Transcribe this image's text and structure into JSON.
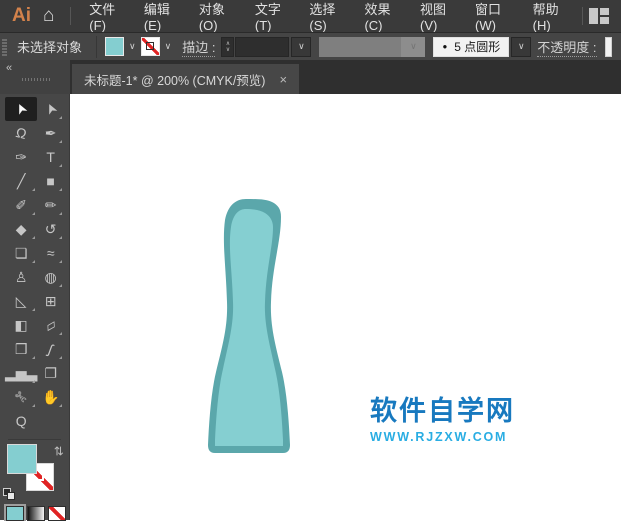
{
  "app": {
    "logo_text": "Ai",
    "home_icon_glyph": "⌂"
  },
  "menu_bar": {
    "items": [
      {
        "id": "file",
        "label": "文件(F)"
      },
      {
        "id": "edit",
        "label": "编辑(E)"
      },
      {
        "id": "object",
        "label": "对象(O)"
      },
      {
        "id": "type",
        "label": "文字(T)"
      },
      {
        "id": "select",
        "label": "选择(S)"
      },
      {
        "id": "effect",
        "label": "效果(C)"
      },
      {
        "id": "view",
        "label": "视图(V)"
      },
      {
        "id": "window",
        "label": "窗口(W)"
      },
      {
        "id": "help",
        "label": "帮助(H)"
      }
    ]
  },
  "control_bar": {
    "status": "未选择对象",
    "fill_swatch_color": "#84CED0",
    "chevron_glyph": "∨",
    "stepper_up": "∧",
    "stepper_down": "∨",
    "stroke_label": "描边 :",
    "stroke_value": "",
    "brush_preset": {
      "dot": "●",
      "label": "5 点圆形"
    },
    "opacity_label": "不透明度 :"
  },
  "tab_bar": {
    "collapse_glyph": "«",
    "tab_title": "未标题-1* @ 200% (CMYK/预览)",
    "close_glyph": "×"
  },
  "toolbar": {
    "swap_glyph": "⇄",
    "tools": [
      {
        "name": "selection-tool",
        "icon": "selection-arrow-icon",
        "glyph": "➤",
        "rot": -115,
        "active": true
      },
      {
        "name": "direct-selection-tool",
        "icon": "direct-select-arrow-icon",
        "glyph": "➤",
        "rot": -115,
        "flyout": true
      },
      {
        "name": "lasso-tool",
        "icon": "lasso-icon",
        "glyph": "Ω",
        "rot": 14
      },
      {
        "name": "pen-tool",
        "icon": "pen-nib-icon",
        "glyph": "✒",
        "flyout": true
      },
      {
        "name": "curvature-tool",
        "icon": "curvature-pen-icon",
        "glyph": "✑"
      },
      {
        "name": "type-tool",
        "icon": "type-icon",
        "glyph": "T",
        "flyout": true
      },
      {
        "name": "line-segment-tool",
        "icon": "line-icon",
        "glyph": "╱",
        "flyout": true
      },
      {
        "name": "rectangle-tool",
        "icon": "rectangle-icon",
        "glyph": "■",
        "flyout": true
      },
      {
        "name": "paintbrush-tool",
        "icon": "paintbrush-icon",
        "glyph": "✐",
        "flyout": true
      },
      {
        "name": "pencil-tool",
        "icon": "pencil-icon",
        "glyph": "✏",
        "flyout": true
      },
      {
        "name": "eraser-tool",
        "icon": "eraser-icon",
        "glyph": "◆",
        "flyout": true
      },
      {
        "name": "rotate-tool",
        "icon": "rotate-icon",
        "glyph": "↺",
        "flyout": true
      },
      {
        "name": "scale-tool",
        "icon": "scale-icon",
        "glyph": "❏",
        "flyout": true
      },
      {
        "name": "width-tool",
        "icon": "width-icon",
        "glyph": "≈",
        "flyout": true
      },
      {
        "name": "puppet-warp-tool",
        "icon": "pushpin-icon",
        "glyph": "♙"
      },
      {
        "name": "shape-builder-tool",
        "icon": "shape-builder-icon",
        "glyph": "◍",
        "flyout": true
      },
      {
        "name": "perspective-grid-tool",
        "icon": "perspective-grid-icon",
        "glyph": "◺",
        "flyout": true
      },
      {
        "name": "mesh-tool",
        "icon": "mesh-icon",
        "glyph": "⊞"
      },
      {
        "name": "gradient-tool",
        "icon": "gradient-icon",
        "glyph": "◧"
      },
      {
        "name": "measure-tool",
        "icon": "ruler-icon",
        "glyph": "▱",
        "rot": -30,
        "flyout": true
      },
      {
        "name": "symbol-sprayer-tool",
        "icon": "symbols-icon",
        "glyph": "❒",
        "flyout": true
      },
      {
        "name": "eyedropper-tool",
        "icon": "eyedropper-icon",
        "glyph": "ʃ",
        "rot": 20,
        "flyout": true
      },
      {
        "name": "column-graph-tool",
        "icon": "column-graph-icon",
        "glyph": "▂▅▃",
        "flyout": true
      },
      {
        "name": "artboard-tool",
        "icon": "artboard-icon",
        "glyph": "❐"
      },
      {
        "name": "slice-tool",
        "icon": "knife-icon",
        "glyph": "✄",
        "rot": 45,
        "flyout": true
      },
      {
        "name": "hand-tool",
        "icon": "hand-icon",
        "glyph": "✋",
        "flyout": true
      },
      {
        "name": "zoom-tool",
        "icon": "magnifier-icon",
        "glyph": "Q"
      }
    ]
  },
  "swatches": {
    "fill": "#84CED0",
    "stroke": "none",
    "mode_color": "#84CED0"
  },
  "artwork": {
    "shape": "vase",
    "fill": "#85CFD1",
    "stroke": "#5BA7AB"
  },
  "watermark": {
    "title": "软件自学网",
    "url": "WWW.RJZXW.COM",
    "title_color": "#1879BF",
    "url_color": "#29ADE3"
  }
}
